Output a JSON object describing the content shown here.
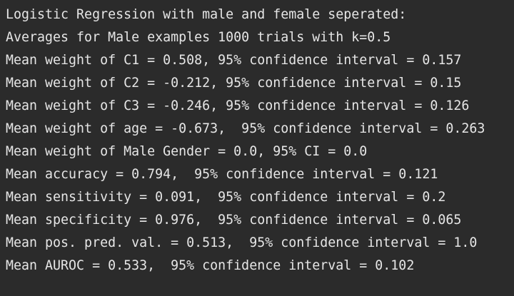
{
  "console": {
    "lines": [
      "Logistic Regression with male and female seperated:",
      "Averages for Male examples 1000 trials with k=0.5",
      "Mean weight of C1 = 0.508, 95% confidence interval = 0.157",
      "Mean weight of C2 = -0.212, 95% confidence interval = 0.15",
      "Mean weight of C3 = -0.246, 95% confidence interval = 0.126",
      "Mean weight of age = -0.673,  95% confidence interval = 0.263",
      "Mean weight of Male Gender = 0.0, 95% CI = 0.0",
      "Mean accuracy = 0.794,  95% confidence interval = 0.121",
      "Mean sensitivity = 0.091,  95% confidence interval = 0.2",
      "Mean specificity = 0.976,  95% confidence interval = 0.065",
      "Mean pos. pred. val. = 0.513,  95% confidence interval = 1.0",
      "Mean AUROC = 0.533,  95% confidence interval = 0.102"
    ]
  },
  "colors": {
    "background": "#2b2b2b",
    "text": "#e6e6e6"
  }
}
